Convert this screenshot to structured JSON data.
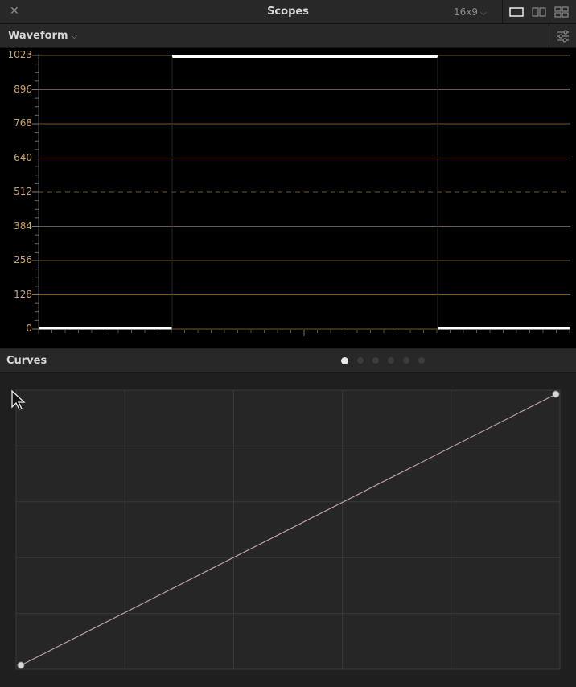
{
  "titlebar": {
    "close_label": "✕",
    "title": "Scopes",
    "aspect": "16x9"
  },
  "scope_toolbar": {
    "scope_name": "Waveform"
  },
  "waveform": {
    "y_ticks": [
      "1023",
      "896",
      "768",
      "640",
      "512",
      "384",
      "256",
      "128",
      "0"
    ],
    "grid_color": "#8a6a2e",
    "label_color": "#c8a36c"
  },
  "curves": {
    "title": "Curves",
    "pages": 6,
    "active_page": 0,
    "line_color": "#b8a0a8"
  }
}
